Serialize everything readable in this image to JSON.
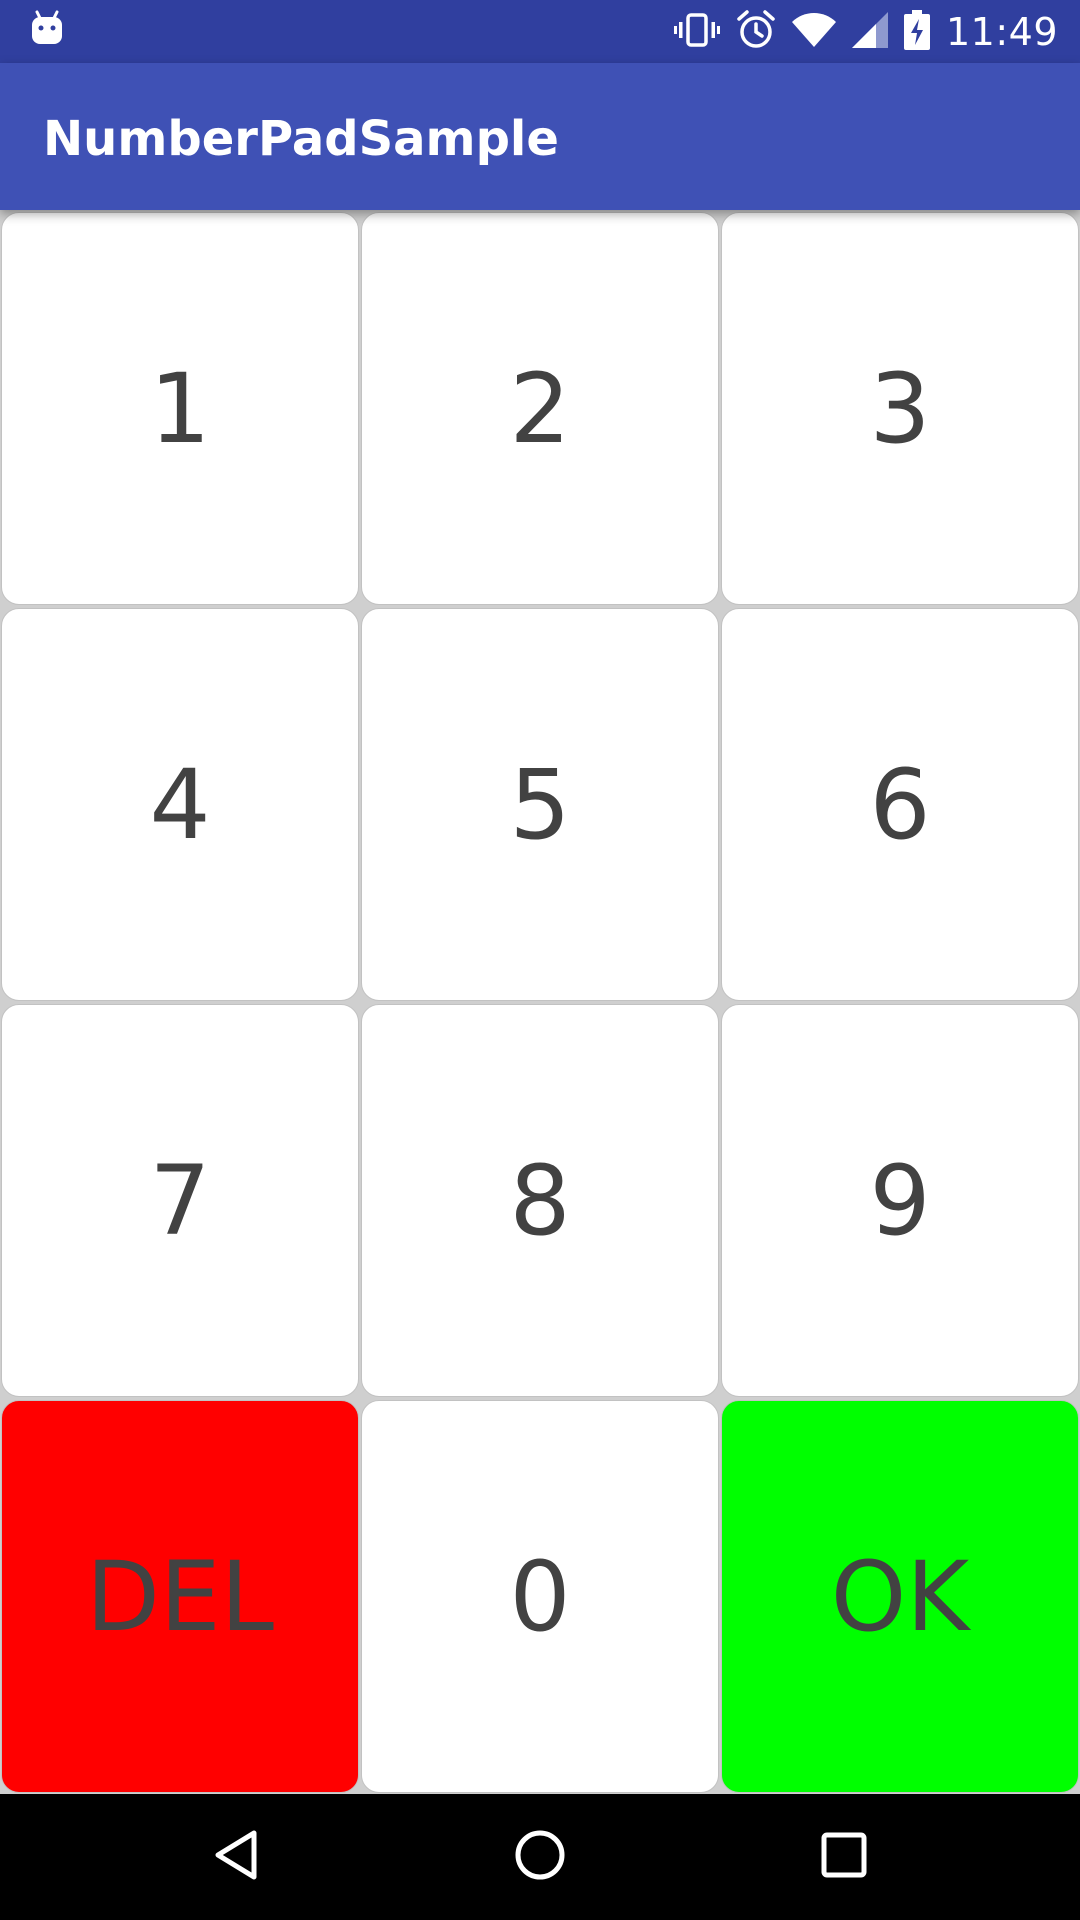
{
  "status_bar": {
    "time": "11:49",
    "icons": [
      "android-debug-icon",
      "vibrate-icon",
      "alarm-icon",
      "wifi-icon",
      "signal-icon",
      "battery-charging-icon"
    ]
  },
  "app_bar": {
    "title": "NumberPadSample"
  },
  "keypad": {
    "keys": [
      {
        "label": "1"
      },
      {
        "label": "2"
      },
      {
        "label": "3"
      },
      {
        "label": "4"
      },
      {
        "label": "5"
      },
      {
        "label": "6"
      },
      {
        "label": "7"
      },
      {
        "label": "8"
      },
      {
        "label": "9"
      },
      {
        "label": "DEL",
        "color": "#ff0000"
      },
      {
        "label": "0"
      },
      {
        "label": "OK",
        "color": "#00ff00"
      }
    ]
  },
  "colors": {
    "status_bar": "#303f9f",
    "app_bar": "#3f51b5",
    "key_background": "#ffffff",
    "key_text": "#424242",
    "keypad_background": "#cfcfcf",
    "delete_key": "#ff0000",
    "ok_key": "#00ff00"
  },
  "nav_bar": {
    "icons": [
      "back-icon",
      "home-icon",
      "recents-icon"
    ]
  }
}
